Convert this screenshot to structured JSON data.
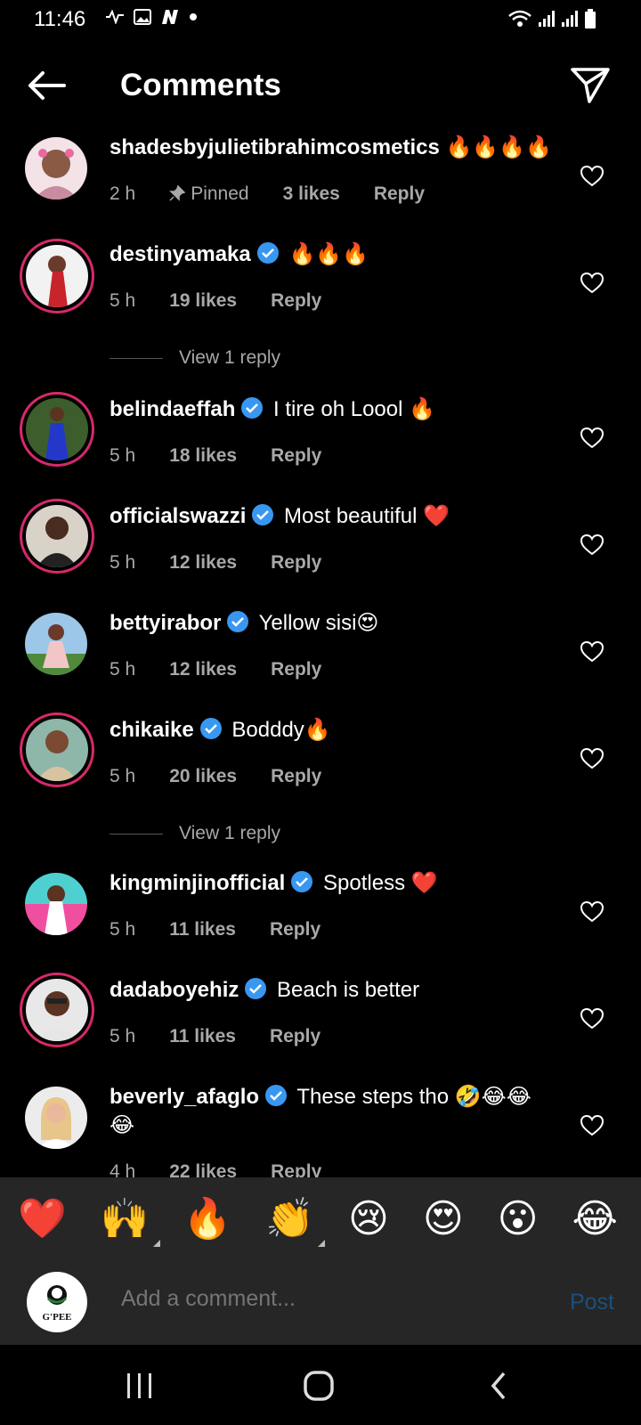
{
  "status_bar": {
    "time": "11:46",
    "left_icons": [
      "wave-icon",
      "image-icon",
      "n-app-icon",
      "dot-icon"
    ],
    "right_icons": [
      "wifi-icon",
      "signal-icon",
      "signal-icon",
      "battery-icon"
    ]
  },
  "header": {
    "title": "Comments",
    "back_icon": "arrow-left-icon",
    "send_icon": "paper-plane-icon"
  },
  "comments": [
    {
      "username": "shadesbyjulietibrahimcosmetics",
      "verified": false,
      "text": "🔥🔥🔥🔥",
      "time": "2 h",
      "pinned": "Pinned",
      "likes": "3 likes",
      "reply": "Reply",
      "story_ring": false
    },
    {
      "username": "destinyamaka",
      "verified": true,
      "text": "🔥🔥🔥",
      "time": "5 h",
      "likes": "19 likes",
      "reply": "Reply",
      "story_ring": true,
      "view_replies": "View 1 reply"
    },
    {
      "username": "belindaeffah",
      "verified": true,
      "text": "I tire oh Loool 🔥",
      "time": "5 h",
      "likes": "18 likes",
      "reply": "Reply",
      "story_ring": true
    },
    {
      "username": "officialswazzi",
      "verified": true,
      "text": "Most beautiful ❤️",
      "time": "5 h",
      "likes": "12 likes",
      "reply": "Reply",
      "story_ring": true
    },
    {
      "username": "bettyirabor",
      "verified": true,
      "text": "Yellow sisi😍",
      "time": "5 h",
      "likes": "12 likes",
      "reply": "Reply",
      "story_ring": false
    },
    {
      "username": "chikaike",
      "verified": true,
      "text": "Bodddy🔥",
      "time": "5 h",
      "likes": "20 likes",
      "reply": "Reply",
      "story_ring": true,
      "view_replies": "View 1 reply"
    },
    {
      "username": "kingminjinofficial",
      "verified": true,
      "text": "Spotless ❤️",
      "time": "5 h",
      "likes": "11 likes",
      "reply": "Reply",
      "story_ring": false
    },
    {
      "username": "dadaboyehiz",
      "verified": true,
      "text": "Beach is better",
      "time": "5 h",
      "likes": "11 likes",
      "reply": "Reply",
      "story_ring": true
    },
    {
      "username": "beverly_afaglo",
      "verified": true,
      "text": "These steps tho 🤣😂😂😂",
      "time": "4 h",
      "likes": "22 likes",
      "reply": "Reply",
      "story_ring": false
    }
  ],
  "emoji_bar": [
    "❤️",
    "🙌",
    "🔥",
    "👏",
    "😢",
    "😍",
    "😮",
    "😂"
  ],
  "composer": {
    "avatar_text": "G'PEE",
    "placeholder": "Add a comment...",
    "post_label": "Post"
  },
  "nav_bar": [
    "recents-icon",
    "home-icon",
    "back-chevron-icon"
  ],
  "colors": {
    "background": "#000000",
    "meta_text": "#a8a8a8",
    "verified_blue": "#3897f0",
    "story_ring": "#d6296a",
    "composer_bg": "#262626",
    "post_disabled": "#1e4f7d"
  }
}
